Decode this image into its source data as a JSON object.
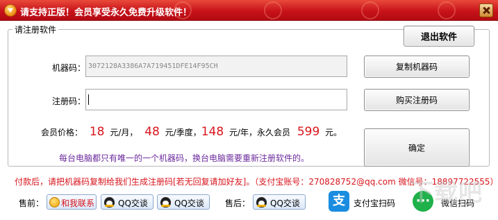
{
  "window": {
    "title": "请支持正版！会员享受永久免费升级软件！"
  },
  "panel": {
    "legend": "请注册软件"
  },
  "buttons": {
    "exit": "退出软件",
    "copy_machine_code": "复制机器码",
    "buy_code": "购买注册码",
    "confirm": "确定"
  },
  "machine_code": {
    "label": "机器码：",
    "value": "3072128A3386A7A719451DFE14F95CH"
  },
  "reg_code": {
    "label": "注册码：",
    "value": ""
  },
  "pricing": {
    "label": "会员价格：",
    "monthly": "18",
    "monthly_unit": "元/月，",
    "quarterly": "48",
    "quarterly_unit": "元/季度，",
    "yearly": "148",
    "yearly_unit": "元/年，永久会员",
    "lifetime": "599",
    "lifetime_unit": "元。"
  },
  "notes": {
    "purple": "每台电脑都只有唯一的一个机器码，换台电脑需要重新注册软件的。",
    "red": "付款后，请把机器码复制给我们生成注册码[若无回复请加好友]。（支付宝账号：270828752@qq.com  微信号：18897722555）"
  },
  "presale": {
    "label": "售前：",
    "contact": "和我联系",
    "qq1": "QQ交谈",
    "qq2": "QQ交谈"
  },
  "aftersale": {
    "label": "售后：",
    "qq": "QQ交谈"
  },
  "payment": {
    "alipay": "支付宝扫码",
    "wechat": "微信扫码"
  },
  "watermark": "下载吧",
  "colors": {
    "title_red": "#c8121a",
    "price_red": "#d8141c",
    "note_purple": "#6b2a9c"
  }
}
